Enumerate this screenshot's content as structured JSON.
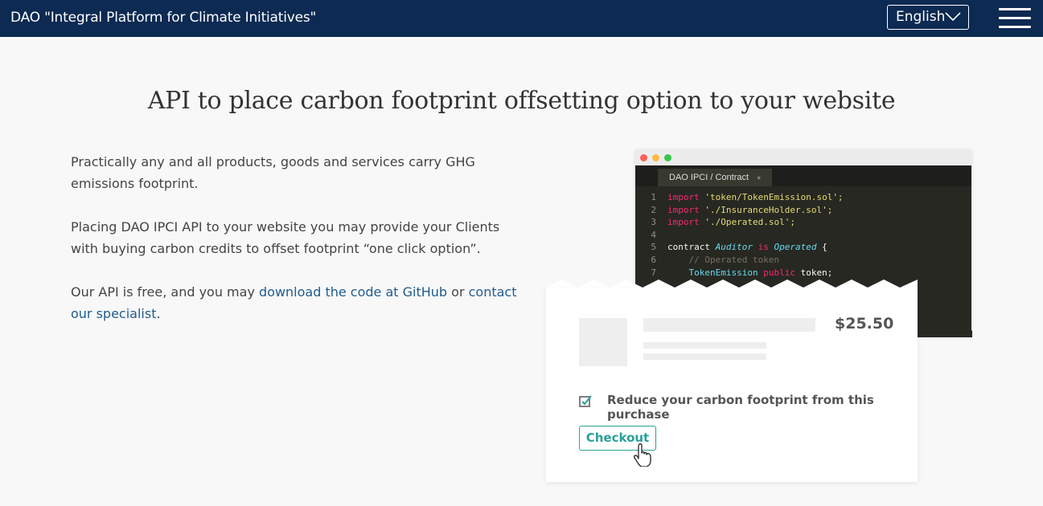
{
  "header": {
    "brand": "DAO \"Integral Platform for Climate Initiatives\"",
    "language": "English",
    "menu_icon": "hamburger-menu-icon"
  },
  "main": {
    "title": "API to place carbon footprint offsetting option to your website",
    "paragraph1": "Practically any and all products, goods and services carry GHG emissions footprint.",
    "paragraph2": "Placing DAO IPCI API to your website you may provide your Clients with buying carbon credits to offset footprint “one click option”.",
    "paragraph3_prefix": "Our API is free, and you may ",
    "github_link": "download the code at GitHub",
    "paragraph3_middle": " or ",
    "contact_link": "contact our specialist",
    "paragraph3_suffix": "."
  },
  "illustration": {
    "editor_tab": "DAO IPCI / Contract",
    "code_lines": [
      {
        "n": "1",
        "kw": "import",
        "rest": " 'token/TokenEmission.sol';"
      },
      {
        "n": "2",
        "kw": "import",
        "rest": " './InsuranceHolder.sol';"
      },
      {
        "n": "3",
        "kw": "import",
        "rest": " './Operated.sol';"
      },
      {
        "n": "4"
      },
      {
        "n": "5",
        "text": "contract Auditor is Operated {"
      },
      {
        "n": "6",
        "text": "    // Operated token"
      },
      {
        "n": "7",
        "text": "    TokenEmission public token;"
      }
    ],
    "price": "$25.50",
    "offset_label": "Reduce your carbon footprint from this purchase",
    "checkout_label": "Checkout",
    "colors": {
      "accent": "#2aa198",
      "header": "#0c2a52",
      "link": "#1f5c8f"
    }
  }
}
